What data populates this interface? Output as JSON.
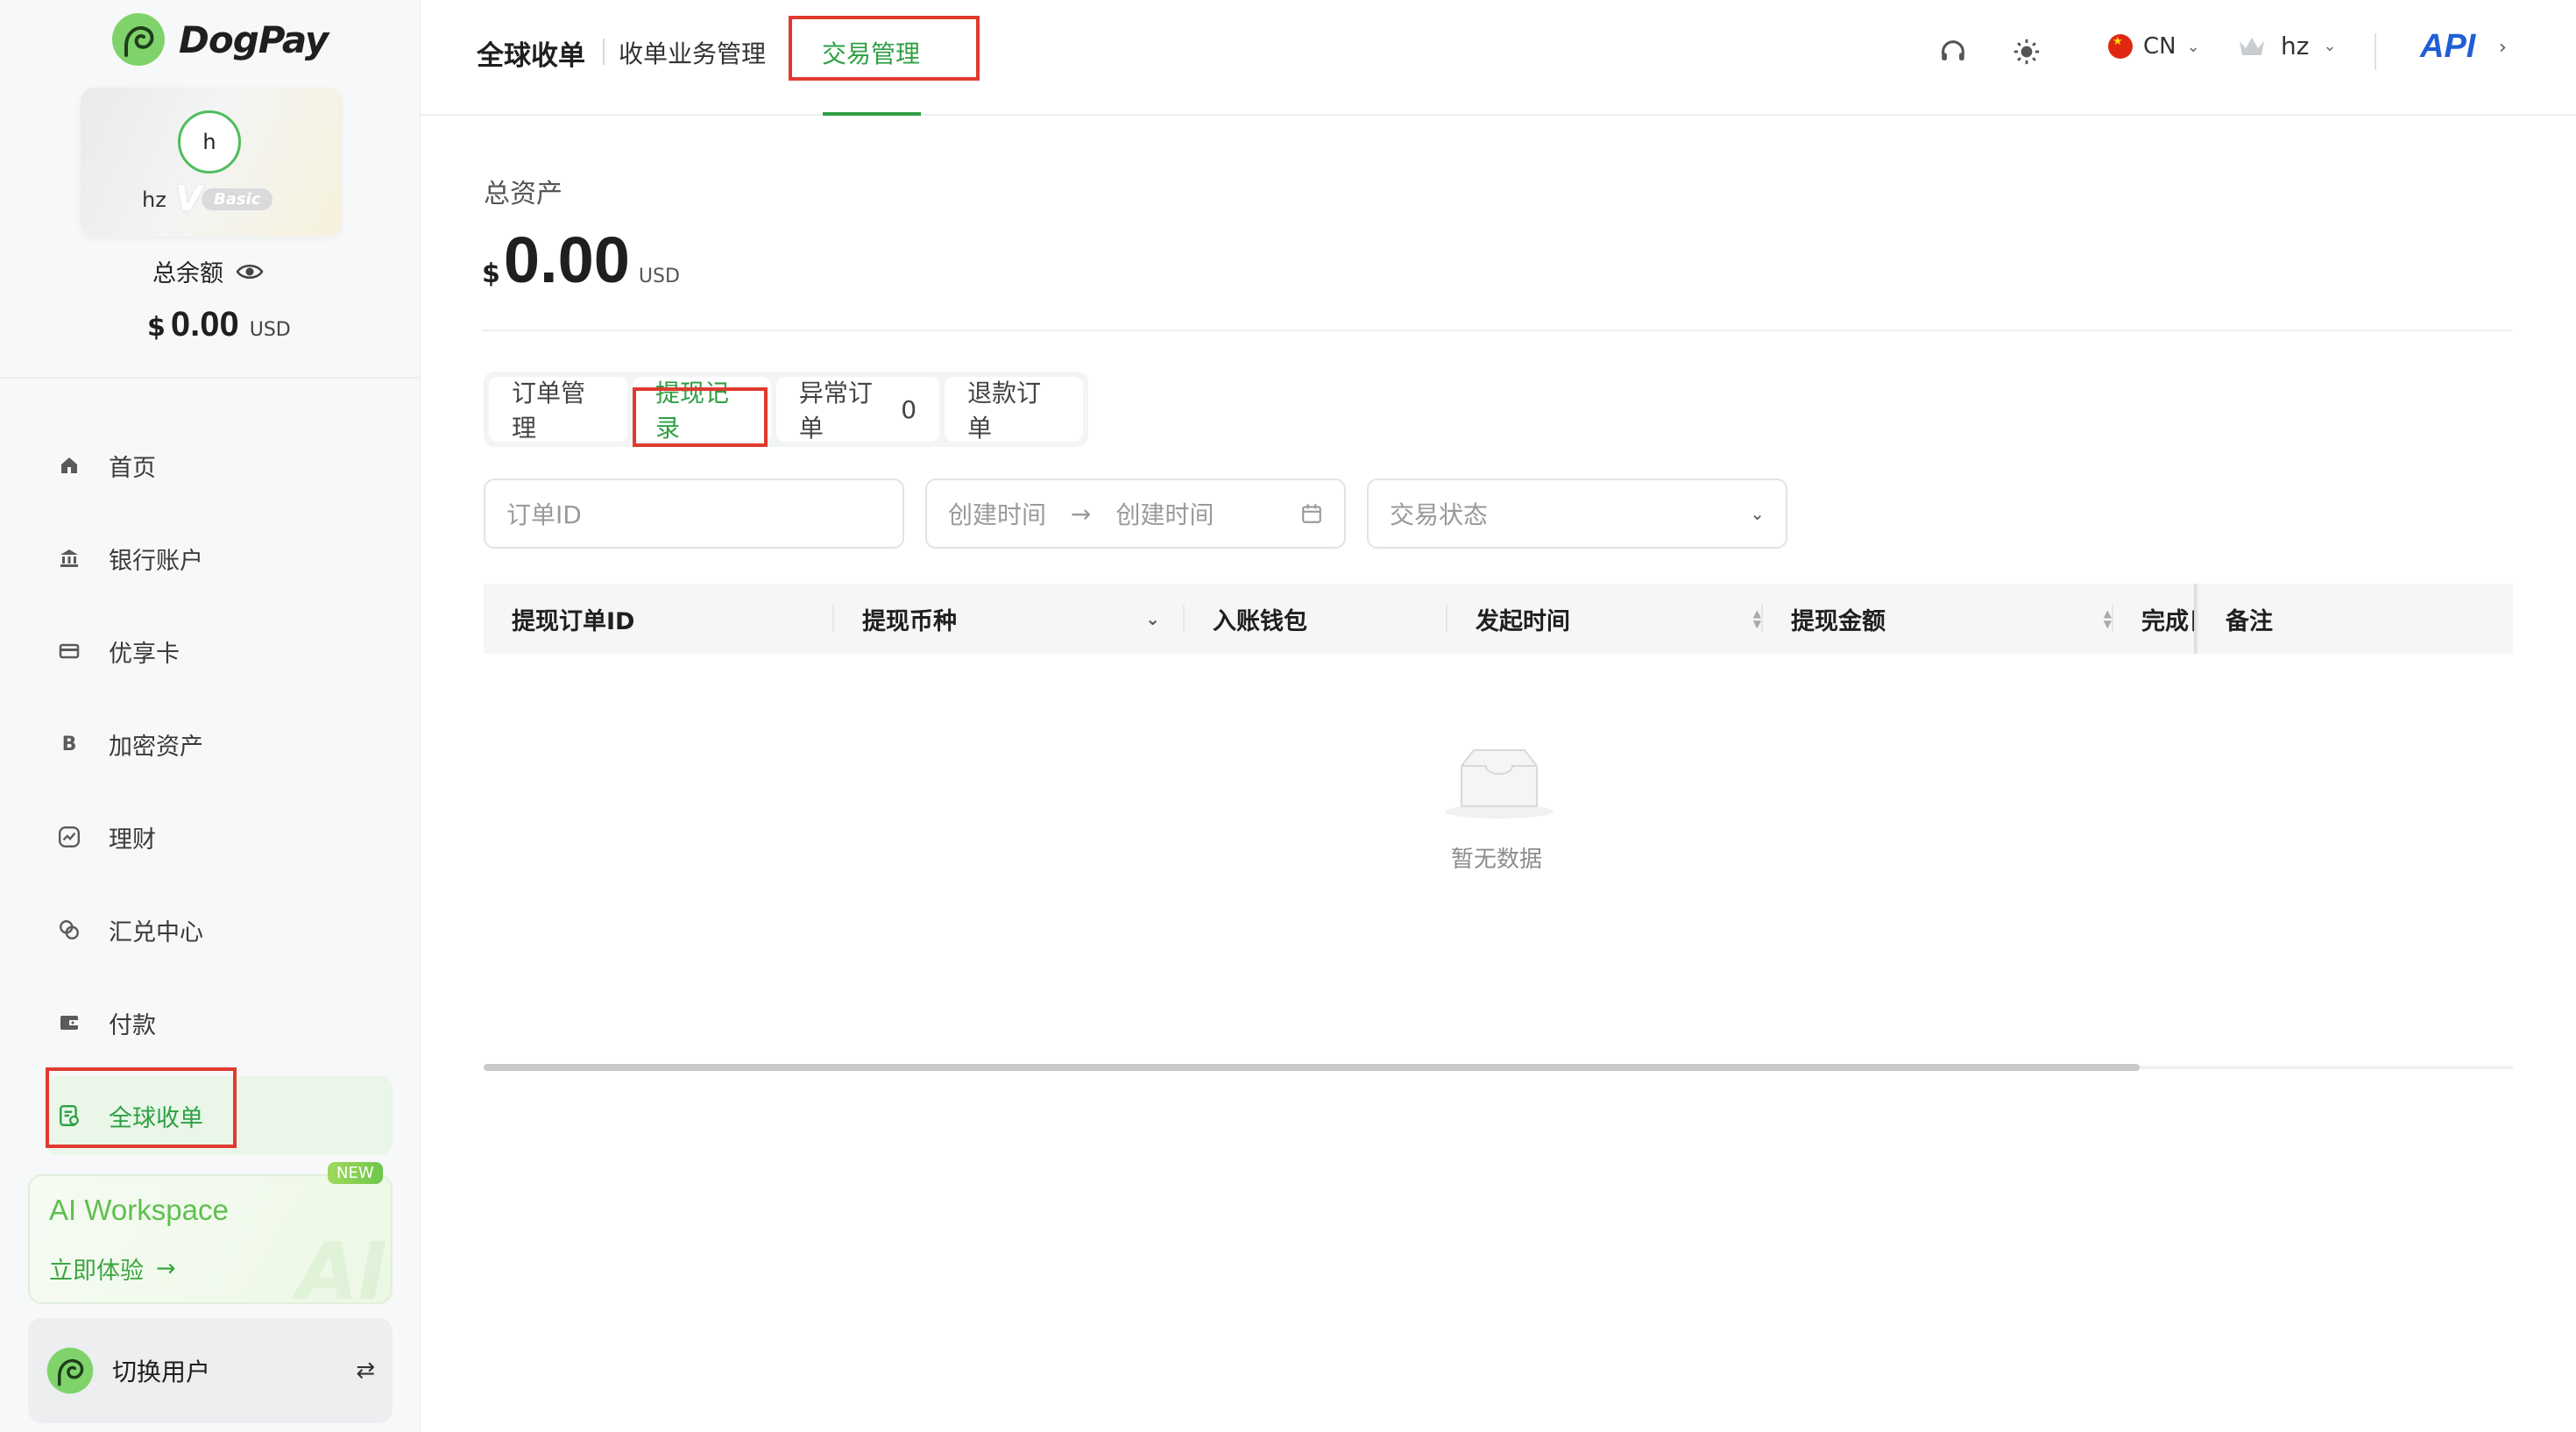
{
  "brand": {
    "name": "DogPay",
    "accent": "#2ea043",
    "highlight": "#e03a2f"
  },
  "profile": {
    "initial": "h",
    "username": "hz",
    "tier_mark": "V",
    "tier_badge": "Basic",
    "balance_label": "总余额",
    "balance_currency": "$",
    "balance_amount": "0.00",
    "balance_unit": "USD"
  },
  "sidebar": {
    "items": [
      {
        "label": "首页",
        "icon": "home-icon"
      },
      {
        "label": "银行账户",
        "icon": "bank-icon"
      },
      {
        "label": "优享卡",
        "icon": "card-icon"
      },
      {
        "label": "加密资产",
        "icon": "bitcoin-icon",
        "glyph": "B"
      },
      {
        "label": "理财",
        "icon": "chart-icon"
      },
      {
        "label": "汇兑中心",
        "icon": "exchange-icon"
      },
      {
        "label": "付款",
        "icon": "wallet-icon"
      },
      {
        "label": "全球收单",
        "icon": "receipt-icon",
        "active": true
      }
    ],
    "ai_card": {
      "title": "AI Workspace",
      "cta": "立即体验",
      "arrow": "→",
      "badge": "NEW",
      "watermark": "AI"
    },
    "switch_user": {
      "label": "切换用户",
      "icon": "⇄"
    }
  },
  "topbar": {
    "title": "全球收单",
    "tabs": [
      {
        "label": "收单业务管理",
        "active": false
      },
      {
        "label": "交易管理",
        "active": true
      }
    ],
    "language": "CN",
    "user": "hz",
    "api_label": "API",
    "api_chevron": "›",
    "chevron": "⌄"
  },
  "main": {
    "asset_label": "总资产",
    "asset_currency": "$",
    "asset_amount": "0.00",
    "asset_unit": "USD",
    "subtabs": [
      {
        "label": "订单管理"
      },
      {
        "label": "提现记录",
        "active": true
      },
      {
        "label": "异常订单",
        "count": "0"
      },
      {
        "label": "退款订单"
      }
    ],
    "filters": {
      "order_id_placeholder": "订单ID",
      "start_time_placeholder": "创建时间",
      "range_arrow": "→",
      "end_time_placeholder": "创建时间",
      "status_placeholder": "交易状态"
    },
    "table": {
      "columns": [
        "提现订单ID",
        "提现币种",
        "入账钱包",
        "发起时间",
        "提现金额",
        "完成日",
        "备注"
      ],
      "empty_text": "暂无数据"
    }
  }
}
